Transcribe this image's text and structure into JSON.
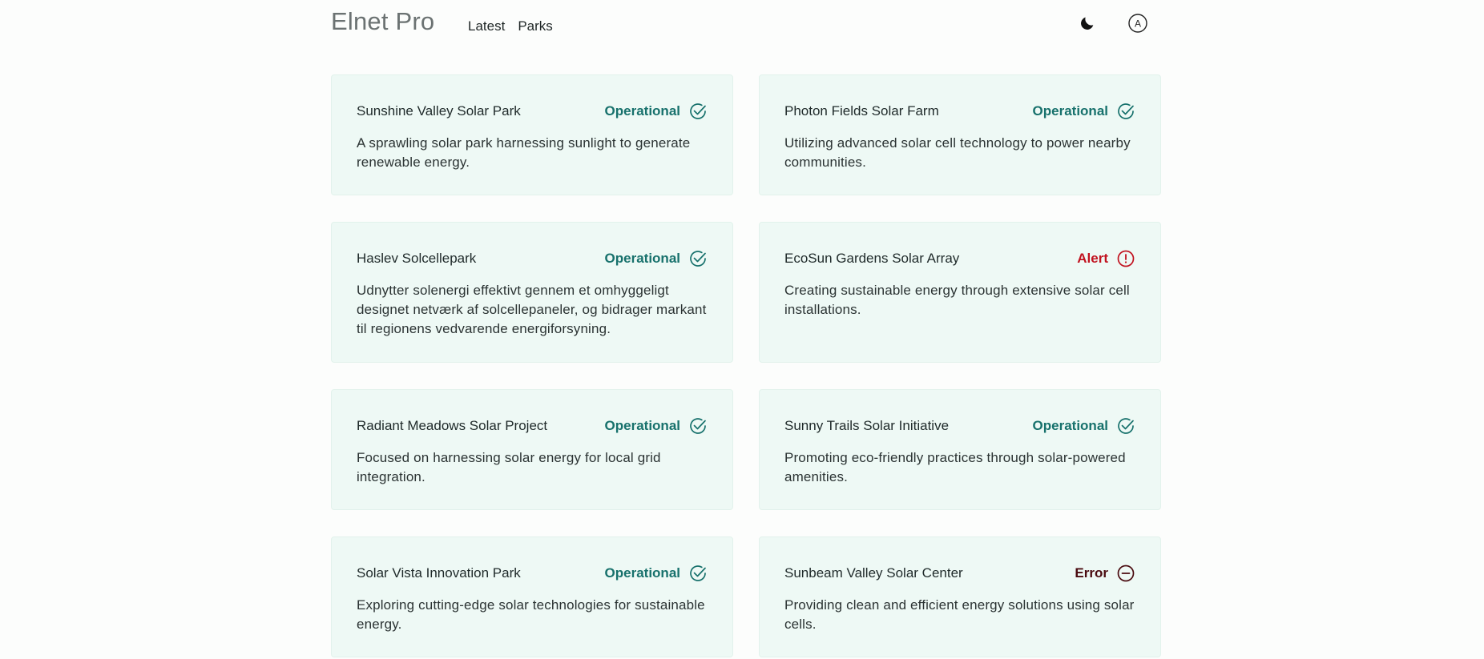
{
  "header": {
    "brand": "Elnet Pro",
    "nav": [
      "Latest",
      "Parks"
    ],
    "theme_icon": "moon-icon",
    "language_icon": "language-a-icon",
    "language_label": "A"
  },
  "colors": {
    "operational": "#17716c",
    "alert": "#c1121f",
    "error": "#4a0b10",
    "card_bg": "#eef9f5"
  },
  "parks": [
    {
      "name": "Sunshine Valley Solar Park",
      "status": "Operational",
      "status_kind": "ok",
      "description": "A sprawling solar park harnessing sunlight to generate renewable energy."
    },
    {
      "name": "Photon Fields Solar Farm",
      "status": "Operational",
      "status_kind": "ok",
      "description": "Utilizing advanced solar cell technology to power nearby communities."
    },
    {
      "name": "Haslev Solcellepark",
      "status": "Operational",
      "status_kind": "ok",
      "description": "Udnytter solenergi effektivt gennem et omhyggeligt designet netværk af solcellepaneler, og bidrager markant til regionens vedvarende energiforsyning."
    },
    {
      "name": "EcoSun Gardens Solar Array",
      "status": "Alert",
      "status_kind": "alert",
      "description": "Creating sustainable energy through extensive solar cell installations."
    },
    {
      "name": "Radiant Meadows Solar Project",
      "status": "Operational",
      "status_kind": "ok",
      "description": "Focused on harnessing solar energy for local grid integration."
    },
    {
      "name": "Sunny Trails Solar Initiative",
      "status": "Operational",
      "status_kind": "ok",
      "description": "Promoting eco-friendly practices through solar-powered amenities."
    },
    {
      "name": "Solar Vista Innovation Park",
      "status": "Operational",
      "status_kind": "ok",
      "description": "Exploring cutting-edge solar technologies for sustainable energy."
    },
    {
      "name": "Sunbeam Valley Solar Center",
      "status": "Error",
      "status_kind": "error",
      "description": "Providing clean and efficient energy solutions using solar cells."
    }
  ]
}
